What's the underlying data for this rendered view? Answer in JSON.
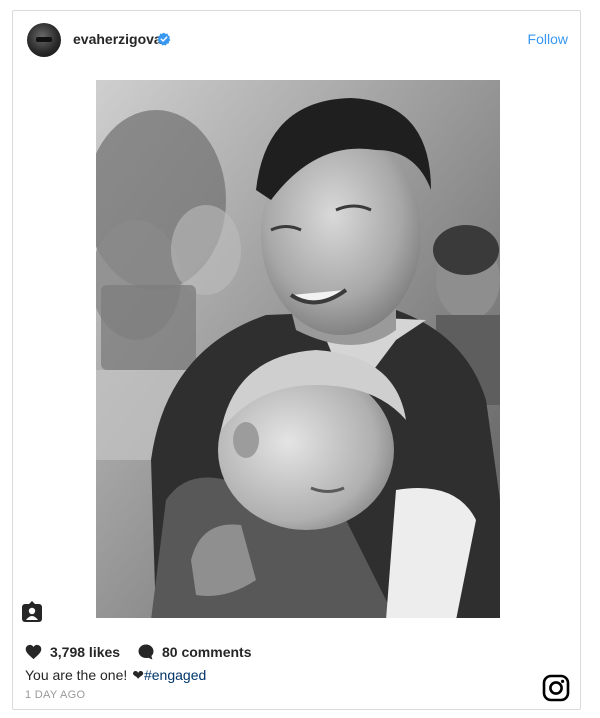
{
  "post": {
    "username": "evaherzigova",
    "verified": true,
    "follow_label": "Follow",
    "likes": "3,798 likes",
    "comments": "80 comments",
    "caption_text": "You are the one!",
    "caption_emoji": "❤",
    "caption_hashtag": "#engaged",
    "timestamp": "1 DAY AGO"
  },
  "icons": {
    "verified": "verified-badge-icon",
    "tag": "user-tag-icon",
    "like": "heart-icon",
    "comment": "comment-bubble-icon",
    "brand": "instagram-logo-icon"
  },
  "colors": {
    "accent": "#3897f0",
    "hashtag": "#003569",
    "text": "#262626",
    "muted": "#999999",
    "border": "#dbdbdb"
  }
}
